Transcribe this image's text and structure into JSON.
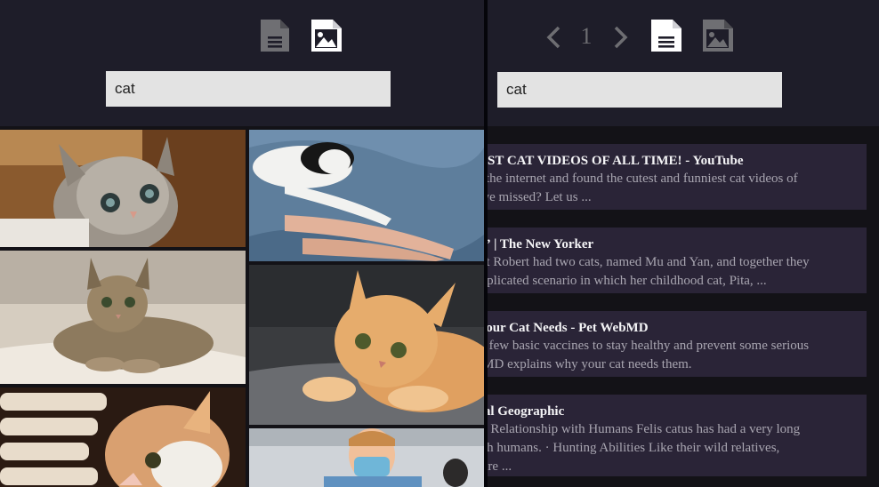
{
  "left": {
    "search": {
      "value": "cat"
    },
    "icons": {
      "doc": "document-icon",
      "image": "image-icon"
    },
    "grid_tiles": [
      "kitten-gray-wood-photo",
      "black-white-cat-bed-photo",
      "tabby-cat-blanket-photo",
      "orange-kitten-lying-photo",
      "kitten-basket-photo",
      "vet-masked-photo"
    ]
  },
  "right": {
    "pagination": {
      "page": "1",
      "prev_icon": "chevron-left-icon",
      "next_icon": "chevron-right-icon"
    },
    "search": {
      "value": "cat"
    },
    "results": [
      {
        "title": "BEST CAT VIDEOS OF ALL TIME! - YouTube",
        "snippet": [
          "ed the internet and found the cutest and funniest cat videos of",
          "y we missed? Let us ..."
        ]
      },
      {
        "title": "on” | The New Yorker",
        "snippet": [
          " that Robert had two cats, named Mu and Yan, and together they",
          "omplicated scenario in which her childhood cat, Pita, ..."
        ]
      },
      {
        "title": "s Your Cat Needs - Pet WebMD",
        "snippet": [
          "d a few basic vaccines to stay healthy and prevent some serious",
          "ebMD explains why your cat needs them."
        ]
      },
      {
        "title": "onal Geographic",
        "snippet": [
          "at · Relationship with Humans Felis catus has had a very long",
          " with humans. · Hunting Abilities Like their wild relatives,",
          "ts are ..."
        ]
      }
    ]
  },
  "colors": {
    "header_bg": "#1e1d29",
    "page_bg": "#131217",
    "result_bg": "#2a2437",
    "search_bg": "#e3e3e3"
  }
}
